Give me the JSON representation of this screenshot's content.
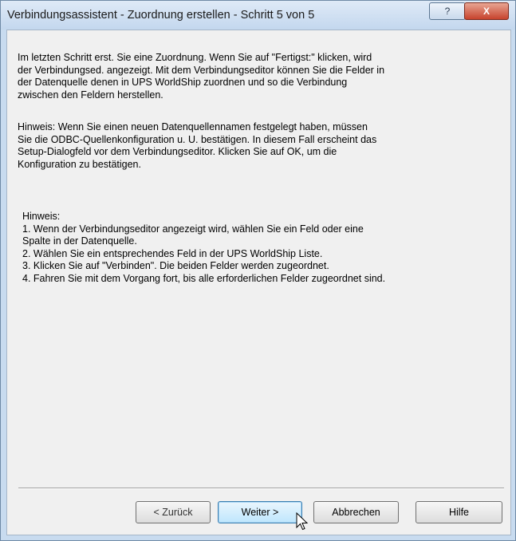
{
  "window": {
    "title": "Verbindungsassistent - Zuordnung erstellen - Schritt 5 von 5",
    "help_glyph": "?",
    "close_glyph": "X"
  },
  "content": {
    "paragraph1": "Im letzten Schritt erst. Sie eine Zuordnung. Wenn Sie auf \"Fertigst:\" klicken, wird\nder Verbindungsed. angezeigt. Mit dem Verbindungseditor können Sie die Felder in\nder Datenquelle denen in UPS WorldShip zuordnen und so die Verbindung\nzwischen den Feldern herstellen.",
    "paragraph2": "Hinweis: Wenn Sie einen neuen Datenquellennamen festgelegt haben, müssen\nSie die ODBC-Quellenkonfiguration u. U. bestätigen. In diesem Fall erscheint das\nSetup-Dialogfeld vor dem Verbindungseditor. Klicken Sie auf OK, um die\nKonfiguration zu bestätigen.",
    "hint_block": "Hinweis:\n1. Wenn der Verbindungseditor angezeigt wird, wählen Sie ein Feld oder eine\nSpalte in der Datenquelle.\n2. Wählen Sie ein entsprechendes Feld in der UPS WorldShip Liste.\n3. Klicken Sie auf \"Verbinden\". Die beiden Felder werden zugeordnet.\n4. Fahren Sie mit dem Vorgang fort, bis alle erforderlichen Felder zugeordnet sind."
  },
  "buttons": {
    "back": "< Zurück",
    "next": "Weiter >",
    "cancel": "Abbrechen",
    "help": "Hilfe"
  }
}
